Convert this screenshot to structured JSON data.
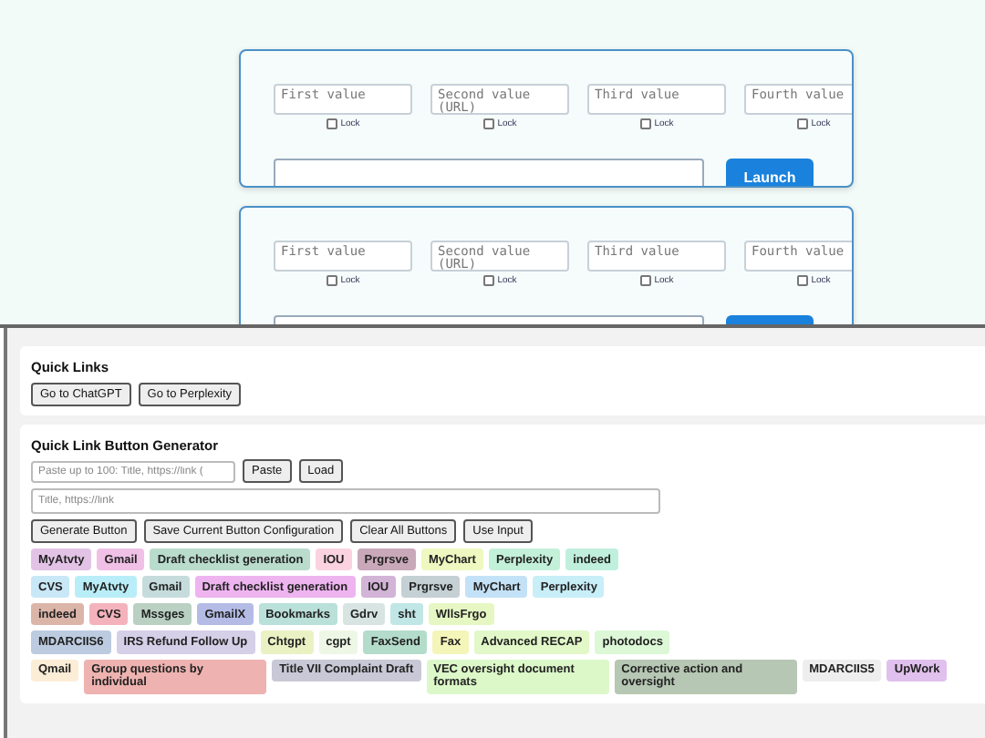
{
  "launcher_cards": [
    {
      "fields": [
        {
          "placeholder": "First value",
          "lock": {
            "label": "Lock",
            "checked": false
          }
        },
        {
          "placeholder": "Second value (URL)",
          "lock": {
            "label": "Lock",
            "checked": false
          }
        },
        {
          "placeholder": "Third value",
          "lock": {
            "label": "Lock",
            "checked": false
          }
        },
        {
          "placeholder": "Fourth value",
          "lock": {
            "label": "Lock",
            "checked": false
          }
        }
      ],
      "launch": "Launch"
    },
    {
      "fields": [
        {
          "placeholder": "First value",
          "lock": {
            "label": "Lock",
            "checked": false
          }
        },
        {
          "placeholder": "Second value (URL)",
          "lock": {
            "label": "Lock",
            "checked": false
          }
        },
        {
          "placeholder": "Third value",
          "lock": {
            "label": "Lock",
            "checked": false
          }
        },
        {
          "placeholder": "Fourth value",
          "lock": {
            "label": "Lock",
            "checked": false
          }
        }
      ]
    }
  ],
  "quick_links": {
    "title": "Quick Links",
    "buttons": [
      "Go to ChatGPT",
      "Go to Perplexity"
    ]
  },
  "generator": {
    "title": "Quick Link Button Generator",
    "paste_placeholder": "Paste up to 100: Title, https://link (",
    "paste_buttons": [
      "Paste",
      "Load"
    ],
    "link_placeholder": "Title, https://link",
    "actions": [
      "Generate Button",
      "Save Current Button Configuration",
      "Clear All Buttons",
      "Use Input"
    ],
    "button_rows": [
      [
        {
          "label": "MyAtvty",
          "color": "#e2c3e6"
        },
        {
          "label": "Gmail",
          "color": "#f0c0e6"
        },
        {
          "label": "Draft checklist generation",
          "color": "#b9dccd"
        },
        {
          "label": "IOU",
          "color": "#fbd3e0"
        },
        {
          "label": "Prgrsve",
          "color": "#c9a9b9"
        },
        {
          "label": "MyChart",
          "color": "#eef8c0"
        },
        {
          "label": "Perplexity",
          "color": "#c3f0d9"
        },
        {
          "label": "indeed",
          "color": "#c0f0dd"
        }
      ],
      [
        {
          "label": "CVS",
          "color": "#c9e8f7"
        },
        {
          "label": "MyAtvty",
          "color": "#b9eef8"
        },
        {
          "label": "Gmail",
          "color": "#c6dcdc"
        },
        {
          "label": "Draft checklist generation",
          "color": "#eeb4f0"
        },
        {
          "label": "IOU",
          "color": "#d2b4d7"
        },
        {
          "label": "Prgrsve",
          "color": "#c4d0d4"
        },
        {
          "label": "MyChart",
          "color": "#c4e2f7"
        },
        {
          "label": "Perplexity",
          "color": "#c8eef8"
        }
      ],
      [
        {
          "label": "indeed",
          "color": "#dcb5a9"
        },
        {
          "label": "CVS",
          "color": "#f4b3bc"
        },
        {
          "label": "Mssges",
          "color": "#b9d0c2"
        },
        {
          "label": "GmailX",
          "color": "#b4bce6"
        },
        {
          "label": "Bookmarks",
          "color": "#b9e0d9"
        },
        {
          "label": "Gdrv",
          "color": "#d7e4e2"
        },
        {
          "label": "sht",
          "color": "#c0e6e6"
        },
        {
          "label": "WllsFrgo",
          "color": "#e6f7c4"
        }
      ],
      [
        {
          "label": "MDARCIIS6",
          "color": "#bccbe0"
        },
        {
          "label": "IRS Refund Follow Up",
          "color": "#d6cfe8"
        },
        {
          "label": "Chtgpt",
          "color": "#eaf2c4"
        },
        {
          "label": "cgpt",
          "color": "#eef7e6"
        },
        {
          "label": "FaxSend",
          "color": "#b4dccb"
        },
        {
          "label": "Fax",
          "color": "#f4f5b8"
        },
        {
          "label": "Advanced RECAP",
          "color": "#e2f8c8"
        },
        {
          "label": "photodocs",
          "color": "#dcf8d6"
        }
      ],
      [
        {
          "label": "Qmail",
          "color": "#fcedd7"
        },
        {
          "label": "Group questions by individual",
          "color": "#eeb3b0"
        },
        {
          "label": "Title VII Complaint Draft",
          "color": "#c8c8d6"
        },
        {
          "label": "VEC oversight document formats",
          "color": "#dcf8c8"
        },
        {
          "label": "Corrective action and oversight",
          "color": "#b6c7b3"
        },
        {
          "label": "MDARCIIS5",
          "color": "#eeeeee"
        },
        {
          "label": "UpWork",
          "color": "#e0c0ec"
        }
      ]
    ]
  }
}
